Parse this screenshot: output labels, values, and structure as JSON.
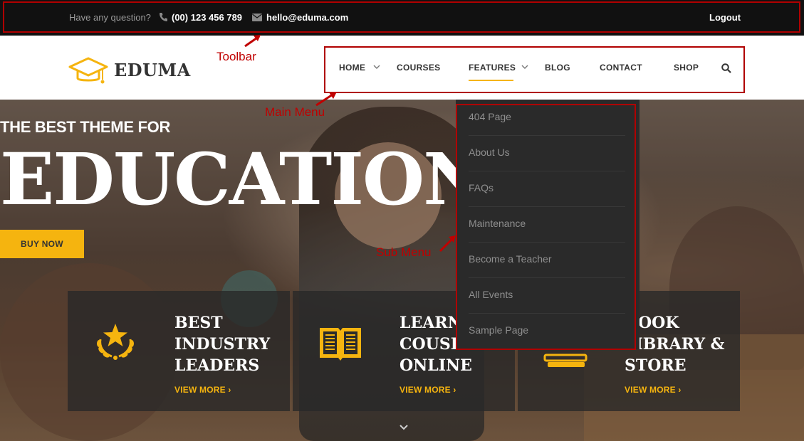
{
  "toolbar": {
    "question": "Have any question?",
    "phone": "(00) 123 456 789",
    "email": "hello@eduma.com",
    "logout": "Logout"
  },
  "logo": {
    "text": "EDUMA"
  },
  "nav": {
    "items": [
      {
        "label": "HOME",
        "has_dropdown": true
      },
      {
        "label": "COURSES",
        "has_dropdown": false
      },
      {
        "label": "FEATURES",
        "has_dropdown": true,
        "active": true
      },
      {
        "label": "BLOG",
        "has_dropdown": false
      },
      {
        "label": "CONTACT",
        "has_dropdown": false
      },
      {
        "label": "SHOP",
        "has_dropdown": false
      }
    ],
    "search_icon": "search-icon"
  },
  "submenu": {
    "items": [
      "404 Page",
      "About Us",
      "FAQs",
      "Maintenance",
      "Become a Teacher",
      "All Events",
      "Sample Page"
    ]
  },
  "hero": {
    "subtitle": "THE BEST THEME FOR",
    "title": "EDUCATION",
    "buy_button": "BUY NOW",
    "features": [
      {
        "title": "BEST INDUSTRY LEADERS",
        "link": "VIEW MORE ›",
        "icon": "award-star-icon"
      },
      {
        "title": "LEARN COUSES ONLINE",
        "link": "VIEW MORE ›",
        "icon": "open-book-icon"
      },
      {
        "title": "BOOK LIBRARY & STORE",
        "link": "VIEW MORE ›",
        "icon": "books-stack-icon"
      }
    ]
  },
  "annotations": {
    "toolbar": "Toolbar",
    "main_menu": "Main Menu",
    "sub_menu": "Sub Menu"
  },
  "colors": {
    "accent": "#f5b40f",
    "toolbar_bg": "#111111",
    "annotation": "#c00000",
    "submenu_bg": "#2a2a2a"
  }
}
